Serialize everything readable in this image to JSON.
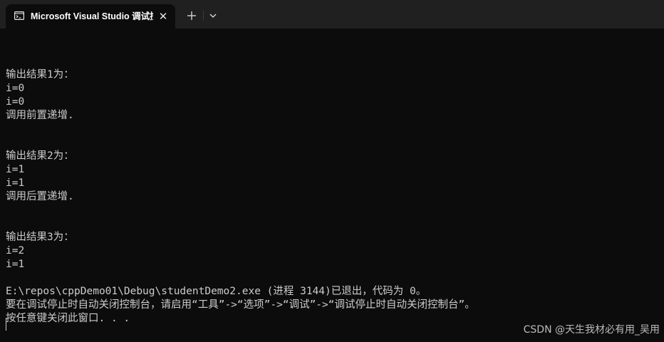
{
  "window": {
    "tab_title": "Microsoft Visual Studio 调试控",
    "tab_icon": "terminal-icon",
    "close_glyph": "✕",
    "new_tab_icon": "plus-icon",
    "dropdown_icon": "chevron-down-icon"
  },
  "console": {
    "lines": [
      "",
      "输出结果1为：",
      "i=0",
      "i=0",
      "调用前置递增.",
      "",
      "",
      "输出结果2为：",
      "i=1",
      "i=1",
      "调用后置递增.",
      "",
      "",
      "输出结果3为：",
      "i=2",
      "i=1",
      "",
      "E:\\repos\\cppDemo01\\Debug\\studentDemo2.exe (进程 3144)已退出，代码为 0。",
      "要在调试停止时自动关闭控制台，请启用“工具”->“选项”->“调试”->“调试停止时自动关闭控制台”。",
      "按任意键关闭此窗口. . ."
    ]
  },
  "watermark": {
    "text": "CSDN @天生我材必有用_吴用"
  },
  "colors": {
    "background": "#0c0c0c",
    "titlebar": "#202020",
    "text": "#cccccc"
  }
}
